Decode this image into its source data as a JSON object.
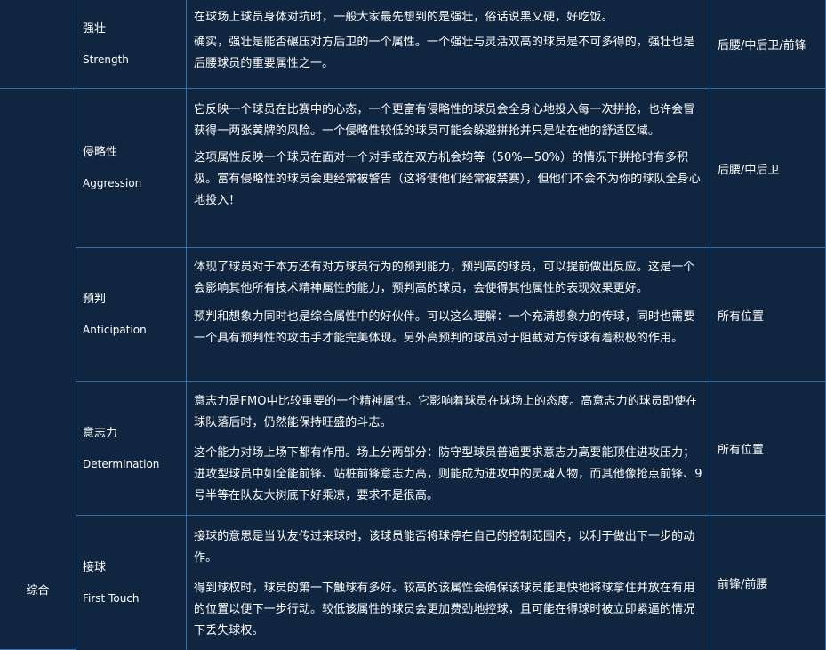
{
  "category": "综合",
  "rows": [
    {
      "cn": "强壮",
      "en": "Strength",
      "desc": [
        "在球场上球员身体对抗时，一般大家最先想到的是强壮，俗话说黑又硬，好吃饭。",
        "确实，强壮是能否碾压对方后卫的一个属性。一个强壮与灵活双高的球员是不可多得的，强壮也是后腰球员的重要属性之一。"
      ],
      "pos": "后腰/中后卫/前锋"
    },
    {
      "cn": "侵略性",
      "en": "Aggression",
      "desc": [
        "它反映一个球员在比赛中的心态，一个更富有侵略性的球员会全身心地投入每一次拼抢，也许会冒获得一两张黄牌的风险。一个侵略性较低的球员可能会躲避拼抢并只是站在他的舒适区域。",
        "这项属性反映一个球员在面对一个对手或在双方机会均等（50%—50%）的情况下拼抢时有多积极。富有侵略性的球员会更经常被警告（这将使他们经常被禁赛），但他们不会不为你的球队全身心地投入！"
      ],
      "pos": "后腰/中后卫"
    },
    {
      "cn": "预判",
      "en": "Anticipation",
      "desc": [
        "体现了球员对于本方还有对方球员行为的预判能力，预判高的球员，可以提前做出反应。这是一个会影响其他所有技术精神属性的能力，预判高的球员，会使得其他属性的表现效果更好。",
        "预判和想象力同时也是综合属性中的好伙伴。可以这么理解：一个充满想象力的传球，同时也需要一个具有预判性的攻击手才能完美体现。另外高预判的球员对于阻截对方传球有着积极的作用。"
      ],
      "pos": "所有位置"
    },
    {
      "cn": "意志力",
      "en": "Determination",
      "desc": [
        "意志力是FMO中比较重要的一个精神属性。它影响着球员在球场上的态度。高意志力的球员即使在球队落后时，仍然能保持旺盛的斗志。",
        "这个能力对场上场下都有作用。场上分两部分：防守型球员普遍要求意志力高要能顶住进攻压力；进攻型球员中如全能前锋、站桩前锋意志力高，则能成为进攻中的灵魂人物，而其他像抢点前锋、9号半等在队友大树底下好乘凉，要求不是很高。"
      ],
      "pos": "所有位置"
    },
    {
      "cn": "接球",
      "en": "First Touch",
      "desc": [
        "接球的意思是当队友传过来球时，该球员能否将球停在自己的控制范围内，以利于做出下一步的动作。",
        "得到球权时，球员的第一下触球有多好。较高的该属性会确保该球员能更快地将球拿住并放在有用的位置以便下一步行动。较低该属性的球员会更加费劲地控球，且可能在得球时被立即紧逼的情况下丢失球权。"
      ],
      "pos": "前锋/前腰"
    }
  ]
}
